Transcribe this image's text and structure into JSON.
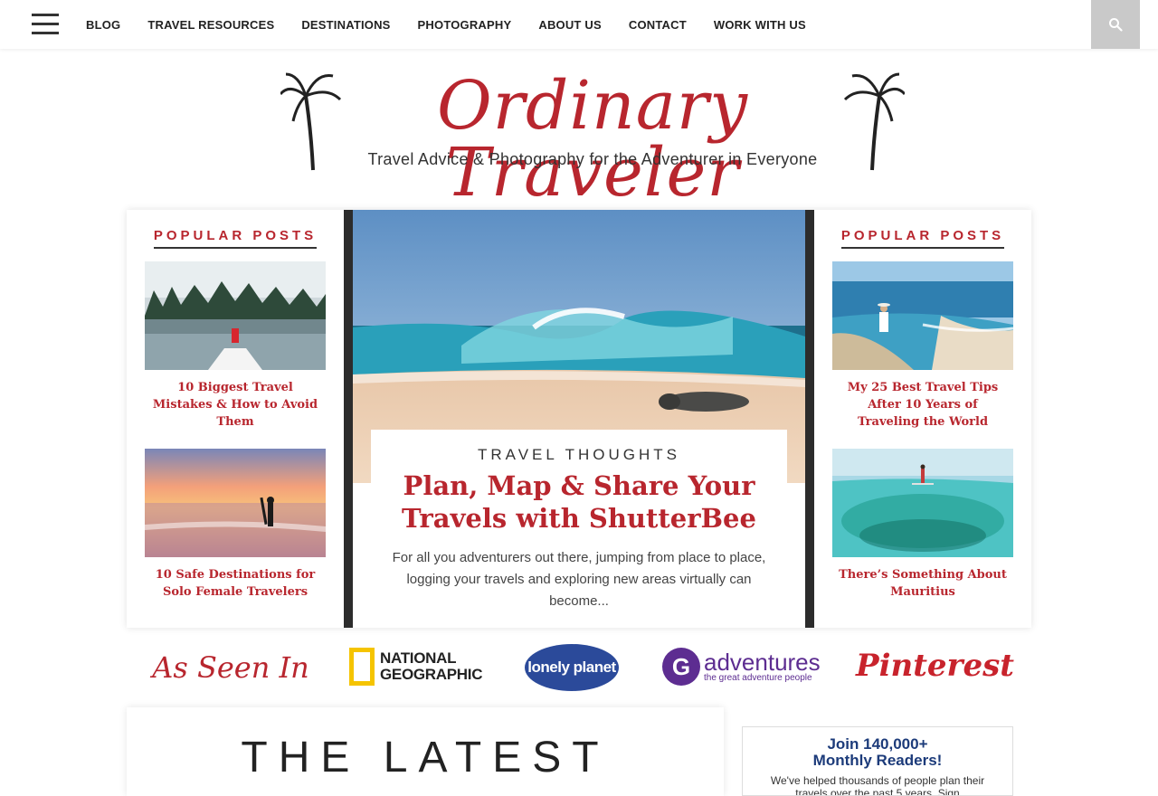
{
  "nav": {
    "items": [
      "BLOG",
      "TRAVEL RESOURCES",
      "DESTINATIONS",
      "PHOTOGRAPHY",
      "ABOUT US",
      "CONTACT",
      "WORK WITH US"
    ]
  },
  "logo": {
    "title": "Ordinary Traveler",
    "tagline": "Travel Advice & Photography for the Adventurer in Everyone"
  },
  "popular_left": {
    "heading": "POPULAR POSTS",
    "posts": [
      {
        "title": "10 Biggest Travel Mistakes & How to Avoid Them"
      },
      {
        "title": "10 Safe Destinations for Solo Female Travelers"
      }
    ]
  },
  "popular_right": {
    "heading": "POPULAR POSTS",
    "posts": [
      {
        "title": "My 25 Best Travel Tips After 10 Years of Traveling the World"
      },
      {
        "title": "There’s Something About Mauritius"
      }
    ]
  },
  "feature": {
    "category": "TRAVEL THOUGHTS",
    "title": "Plan, Map & Share Your Travels with ShutterBee",
    "excerpt": "For all you adventurers out there, jumping from place to place, logging your travels and exploring new areas virtually can become..."
  },
  "seen_in": {
    "label": "As Seen In",
    "logos": [
      "NATIONAL GEOGRAPHIC",
      "lonely planet",
      "adventures",
      "the great adventure people",
      "Pinterest"
    ]
  },
  "latest": {
    "heading": "THE LATEST"
  },
  "join": {
    "title": "Join 140,000+ Monthly Readers!",
    "desc": "We've helped thousands of people plan their travels over the past 5 years. Sign"
  },
  "colors": {
    "accent": "#b8262e",
    "dark": "#2c2c2c"
  }
}
